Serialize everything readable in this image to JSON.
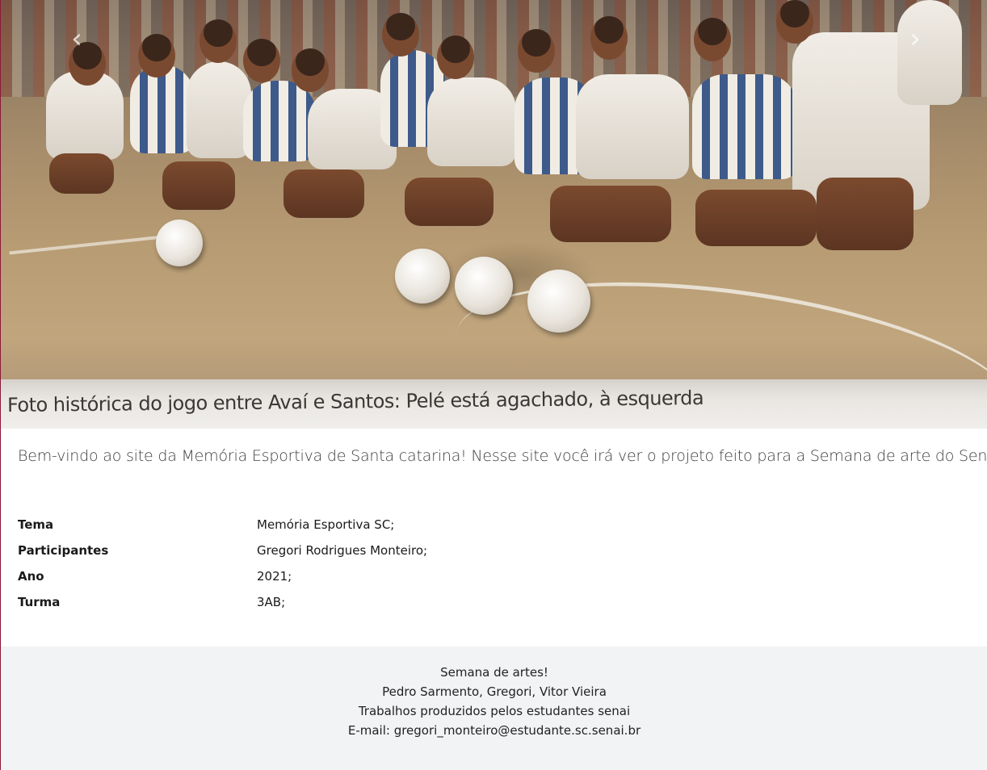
{
  "carousel": {
    "caption": "Foto histórica do jogo entre Avaí e Santos: Pelé está agachado, à esquerda",
    "prev_icon": "chevron-left-icon",
    "next_icon": "chevron-right-icon",
    "prev_glyph": "‹",
    "next_glyph": "›"
  },
  "welcome_text": "Bem-vindo ao site da Memória Esportiva de Santa catarina! Nesse site você irá ver o projeto feito para a Semana de arte do Senai.",
  "info": {
    "rows": [
      {
        "label": "Tema",
        "value": "Memória Esportiva SC;"
      },
      {
        "label": "Participantes",
        "value": "Gregori Rodrigues Monteiro;"
      },
      {
        "label": "Ano",
        "value": "2021;"
      },
      {
        "label": "Turma",
        "value": "3AB;"
      }
    ]
  },
  "footer": {
    "title": "Semana de artes!",
    "authors": "Pedro Sarmento, Gregori, Vitor Vieira",
    "note": "Trabalhos produzidos pelos estudantes senai",
    "email": "E-mail: gregori_monteiro@estudante.sc.senai.br"
  }
}
